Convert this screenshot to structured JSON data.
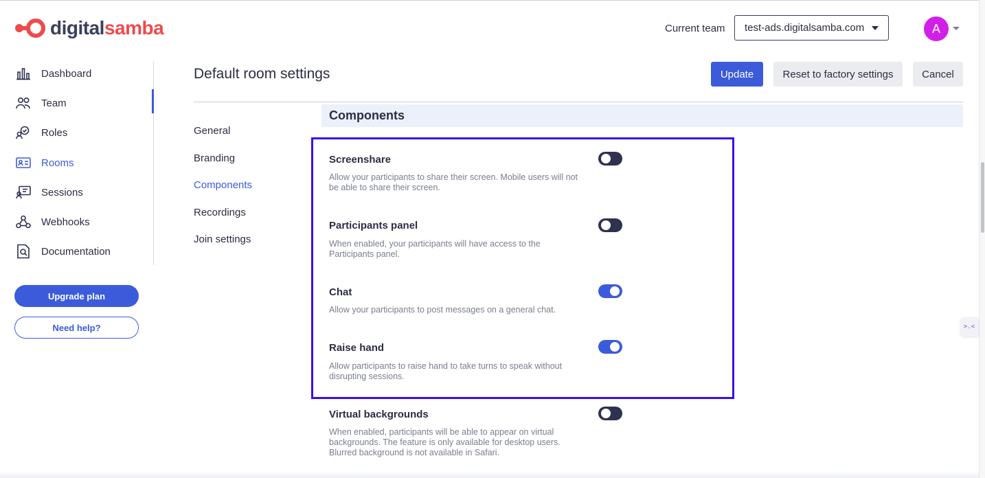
{
  "brand": {
    "name_part1": "digital",
    "name_part2": "samba",
    "colors": {
      "dark": "#3a3f5c",
      "accent": "#ee4b4b"
    }
  },
  "header": {
    "team_label": "Current team",
    "team_value": "test-ads.digitalsamba.com",
    "avatar_initial": "A",
    "avatar_color": "#d21fe8"
  },
  "sidebar": {
    "items": [
      {
        "label": "Dashboard",
        "icon": "bar-chart-icon"
      },
      {
        "label": "Team",
        "icon": "team-icon"
      },
      {
        "label": "Roles",
        "icon": "roles-icon"
      },
      {
        "label": "Rooms",
        "icon": "rooms-icon",
        "active": true
      },
      {
        "label": "Sessions",
        "icon": "sessions-icon"
      },
      {
        "label": "Webhooks",
        "icon": "webhooks-icon"
      },
      {
        "label": "Documentation",
        "icon": "documentation-icon"
      }
    ],
    "upgrade_label": "Upgrade plan",
    "help_label": "Need help?"
  },
  "page": {
    "title": "Default room settings",
    "update_label": "Update",
    "reset_label": "Reset to factory settings",
    "cancel_label": "Cancel"
  },
  "subnav": {
    "items": [
      "General",
      "Branding",
      "Components",
      "Recordings",
      "Join settings"
    ],
    "active": "Components"
  },
  "section": {
    "title": "Components",
    "settings": [
      {
        "title": "Screenshare",
        "desc": "Allow your participants to share their screen. Mobile users will not be able to share their screen.",
        "enabled": false
      },
      {
        "title": "Participants panel",
        "desc": "When enabled, your participants will have access to the Participants panel.",
        "enabled": false
      },
      {
        "title": "Chat",
        "desc": "Allow your participants to post messages on a general chat.",
        "enabled": true
      },
      {
        "title": "Raise hand",
        "desc": "Allow participants to raise hand to take turns to speak without disrupting sessions.",
        "enabled": true
      },
      {
        "title": "Virtual backgrounds",
        "desc": "When enabled, participants will be able to appear on virtual backgrounds. The feature is only available for desktop users. Blurred background is not available in Safari.",
        "enabled": false
      }
    ]
  },
  "widget": {
    "label": ">.<"
  },
  "colors": {
    "primary": "#3b5bdb",
    "highlight": "#3a0cf0",
    "toggle_off": "#2e3150"
  }
}
